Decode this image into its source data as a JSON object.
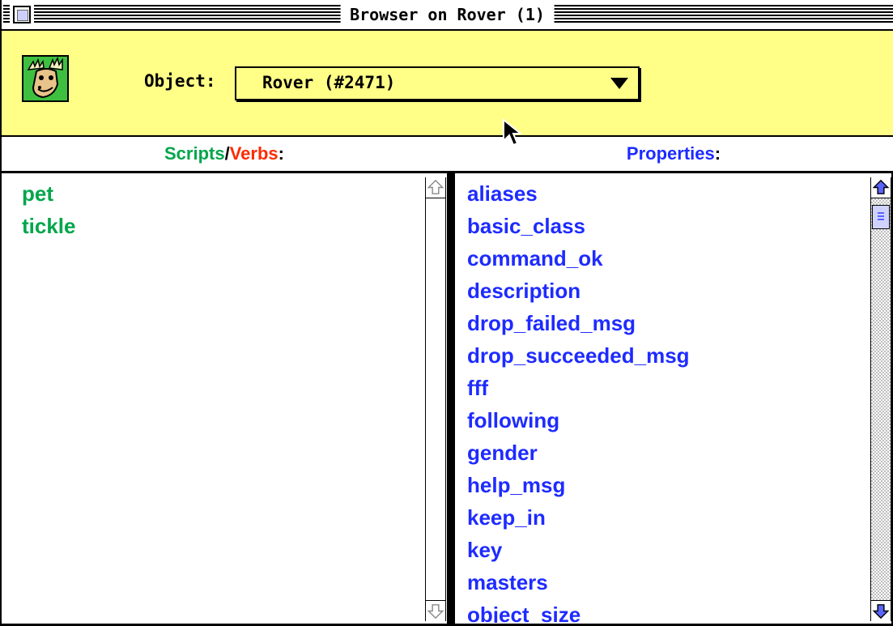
{
  "window": {
    "title": "Browser on Rover (1)"
  },
  "header": {
    "icon": "moose-icon",
    "object_label": "Object:",
    "object_value": "Rover (#2471)"
  },
  "scripts": {
    "header_scripts": "Scripts",
    "header_slash": "/",
    "header_verbs": "Verbs",
    "header_colon": ":",
    "items": [
      "pet",
      "tickle"
    ]
  },
  "properties": {
    "header_label": "Properties",
    "header_colon": ":",
    "items": [
      "aliases",
      "basic_class",
      "command_ok",
      "description",
      "drop_failed_msg",
      "drop_succeeded_msg",
      "fff",
      "following",
      "gender",
      "help_msg",
      "keep_in",
      "key",
      "masters",
      "object_size"
    ]
  },
  "colors": {
    "header_bg": "#ffff88",
    "scripts_green": "#00a64a",
    "verbs_red": "#ff2a00",
    "properties_blue": "#1e2bff"
  }
}
